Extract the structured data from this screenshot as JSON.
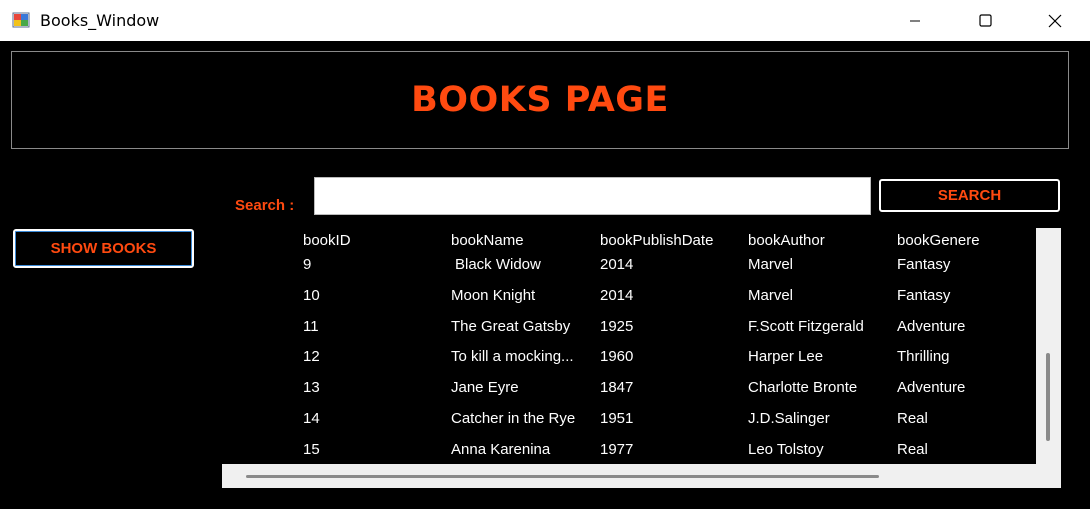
{
  "window": {
    "title": "Books_Window",
    "icon": "app-window-icon"
  },
  "header": {
    "title": "BOOKS PAGE"
  },
  "search": {
    "label": "Search :",
    "value": "",
    "placeholder": "",
    "button_label": "SEARCH"
  },
  "actions": {
    "show_books_label": "SHOW BOOKS"
  },
  "table": {
    "columns": [
      "bookID",
      "bookName",
      "bookPublishDate",
      "bookAuthor",
      "bookGenere"
    ],
    "rows": [
      [
        "9",
        "Black Widow",
        "2014",
        "Marvel",
        "Fantasy"
      ],
      [
        "10",
        "Moon Knight",
        "2014",
        "Marvel",
        "Fantasy"
      ],
      [
        "11",
        "The Great Gatsby",
        "1925",
        "F.Scott Fitzgerald",
        "Adventure"
      ],
      [
        "12",
        "To kill a mocking...",
        "1960",
        "Harper Lee",
        "Thrilling"
      ],
      [
        "13",
        "Jane Eyre",
        "1847",
        "Charlotte Bronte",
        "Adventure"
      ],
      [
        "14",
        "Catcher in the Rye",
        "1951",
        "J.D.Salinger",
        "Real"
      ],
      [
        "15",
        "Anna Karenina",
        "1977",
        "Leo Tolstoy",
        "Real"
      ]
    ]
  },
  "colors": {
    "accent": "#ff4a10",
    "background": "#000000",
    "text": "#ffffff"
  }
}
